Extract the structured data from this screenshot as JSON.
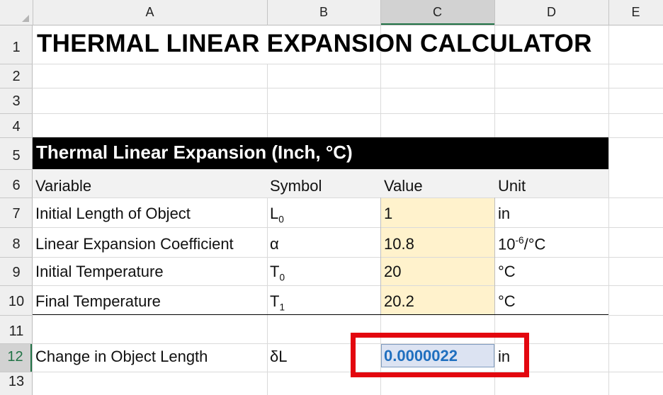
{
  "columns": [
    "A",
    "B",
    "C",
    "D",
    "E"
  ],
  "rows": [
    "1",
    "2",
    "3",
    "4",
    "5",
    "6",
    "7",
    "8",
    "9",
    "10",
    "11",
    "12",
    "13"
  ],
  "title": "THERMAL LINEAR EXPANSION CALCULATOR",
  "section_header": "Thermal Linear Expansion (Inch, °C)",
  "table_headers": {
    "variable": "Variable",
    "symbol": "Symbol",
    "value": "Value",
    "unit": "Unit"
  },
  "inputs": [
    {
      "label": "Initial Length of Object",
      "symbol": "L",
      "symbol_sub": "0",
      "value": "1",
      "unit": "in"
    },
    {
      "label": "Linear Expansion Coefficient",
      "symbol": "α",
      "value": "10.8",
      "unit_base": "10",
      "unit_sup": "-6",
      "unit_rest": "/°C"
    },
    {
      "label": "Initial Temperature",
      "symbol": "T",
      "symbol_sub": "0",
      "value": "20",
      "unit": "°C"
    },
    {
      "label": "Final Temperature",
      "symbol": "T",
      "symbol_sub": "1",
      "value": "20.2",
      "unit": "°C"
    }
  ],
  "result": {
    "label": "Change in Object Length",
    "symbol": "δL",
    "value": "0.0000022",
    "unit": "in"
  },
  "colors": {
    "input_fill": "#fff2cc",
    "result_text": "#1f6fbf",
    "result_fill": "#dce3f2",
    "highlight_box": "#e3070f",
    "selection_green": "#217346"
  }
}
